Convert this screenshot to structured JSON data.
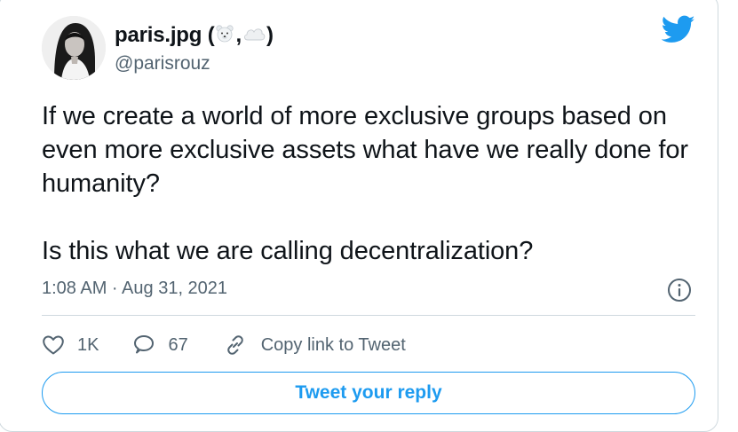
{
  "author": {
    "display_name_prefix": "paris.jpg (",
    "display_name_separator": ",",
    "display_name_suffix": ")",
    "handle": "@parisrouz",
    "emojis": [
      "polar-bear-emoji",
      "cloud-emoji"
    ]
  },
  "tweet": {
    "text": "If we create a world of more exclusive groups based on even more exclusive assets what have we really done for humanity?\n\nIs this what we are calling decentralization?",
    "timestamp": "1:08 AM · Aug 31, 2021"
  },
  "actions": {
    "likes": "1K",
    "replies": "67",
    "copy_label": "Copy link to Tweet"
  },
  "reply_button_label": "Tweet your reply",
  "colors": {
    "brand_blue": "#1d9bf0",
    "text_primary": "#0f1419",
    "text_secondary": "#536471",
    "border": "#cfd9de"
  }
}
